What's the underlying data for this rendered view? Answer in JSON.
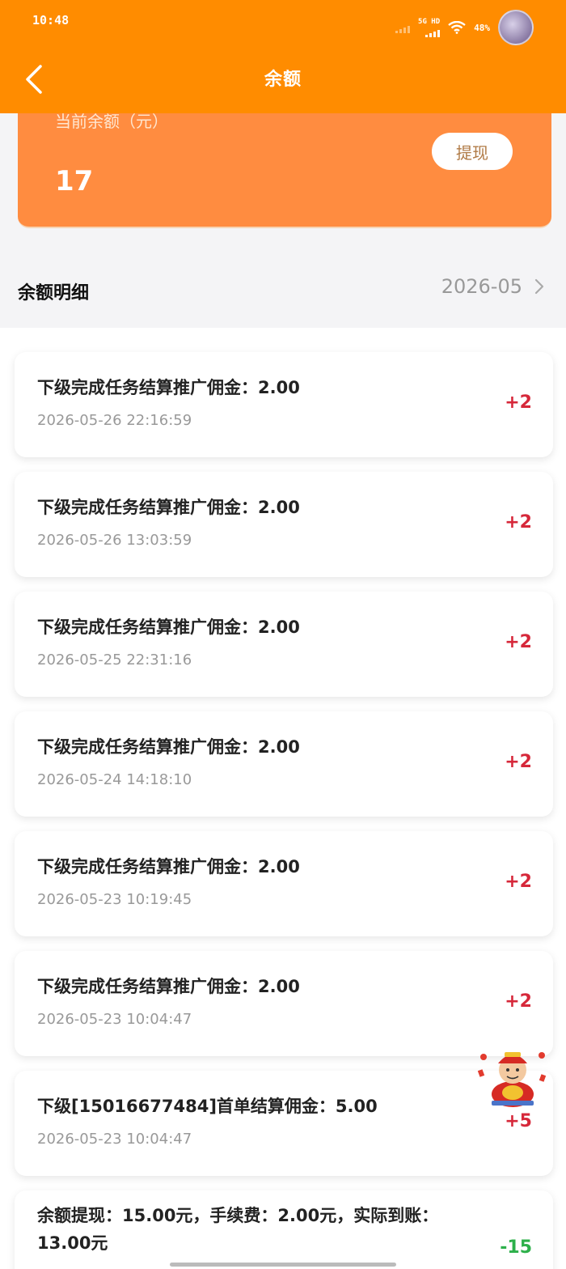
{
  "status_bar": {
    "time": "10:48",
    "network": "5G HD",
    "battery": "48%"
  },
  "header": {
    "title": "余额"
  },
  "balance": {
    "label": "当前余额（元）",
    "amount": "17",
    "withdraw_label": "提现"
  },
  "details": {
    "title": "余额明细",
    "month": "2026-05"
  },
  "records": [
    {
      "desc": "下级完成任务结算推广佣金：2.00",
      "time": "2026-05-26 22:16:59",
      "amount": "+2"
    },
    {
      "desc": "下级完成任务结算推广佣金：2.00",
      "time": "2026-05-26 13:03:59",
      "amount": "+2"
    },
    {
      "desc": "下级完成任务结算推广佣金：2.00",
      "time": "2026-05-25 22:31:16",
      "amount": "+2"
    },
    {
      "desc": "下级完成任务结算推广佣金：2.00",
      "time": "2026-05-24 14:18:10",
      "amount": "+2"
    },
    {
      "desc": "下级完成任务结算推广佣金：2.00",
      "time": "2026-05-23 10:19:45",
      "amount": "+2"
    },
    {
      "desc": "下级完成任务结算推广佣金：2.00",
      "time": "2026-05-23 10:04:47",
      "amount": "+2"
    },
    {
      "desc": "下级[15016677484]首单结算佣金：5.00",
      "time": "2026-05-23 10:04:47",
      "amount": "+5"
    },
    {
      "desc": "余额提现：15.00元，手续费：2.00元，实际到账：13.00元",
      "time": "",
      "amount": "-15"
    }
  ],
  "colors": {
    "primary": "#ff8c00",
    "card": "#ff8c40",
    "positive": "#d6283a",
    "negative": "#2db04a"
  },
  "icons": {
    "back": "chevron-left-icon",
    "month_arrow": "chevron-right-icon",
    "mascot": "fortune-mascot-icon"
  }
}
